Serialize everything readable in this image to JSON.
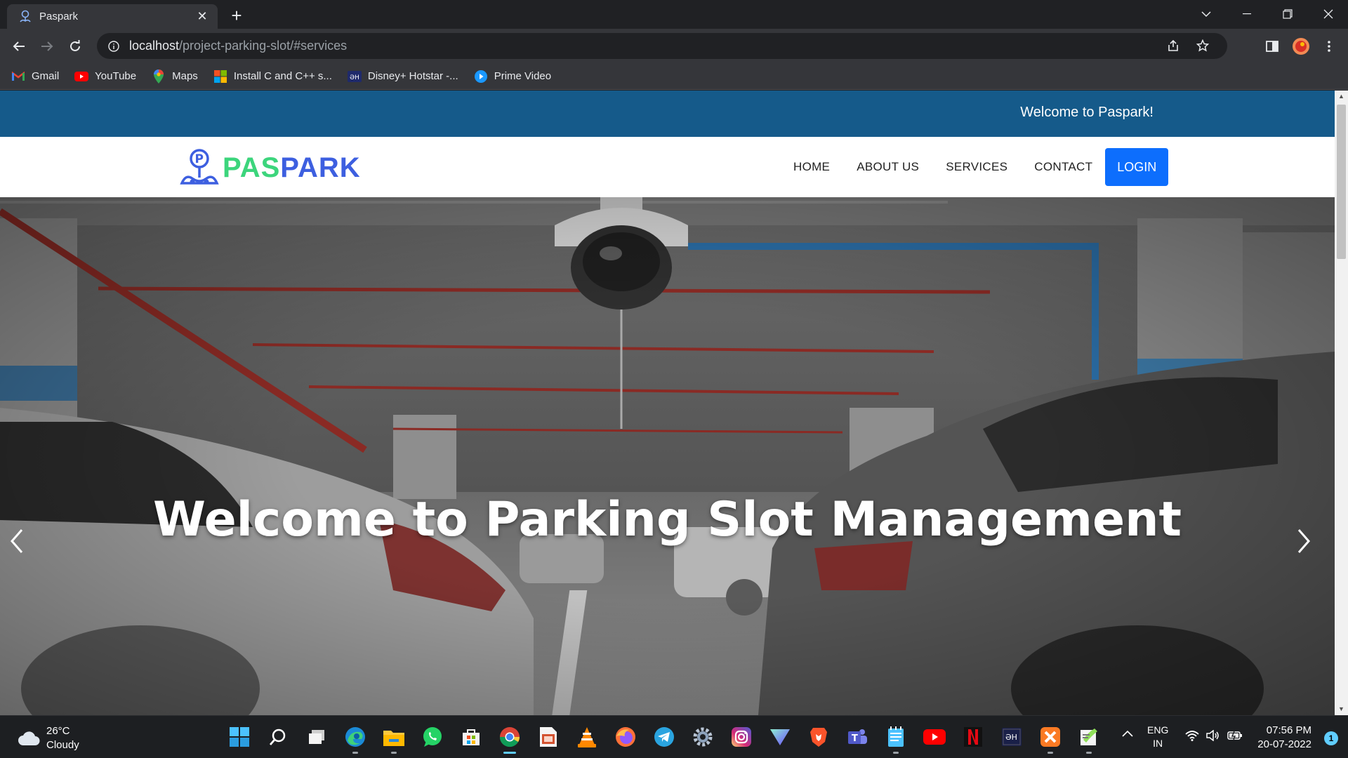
{
  "browser": {
    "tab_title": "Paspark",
    "url_host": "localhost",
    "url_path": "/project-parking-slot/#services",
    "bookmarks": [
      {
        "label": "Gmail",
        "icon": "gmail-icon",
        "color": "#ea4335"
      },
      {
        "label": "YouTube",
        "icon": "youtube-icon",
        "color": "#ff0000"
      },
      {
        "label": "Maps",
        "icon": "maps-icon",
        "color": "#34a853"
      },
      {
        "label": "Install C and C++ s...",
        "icon": "windows-store-icon",
        "color": "#00a4ef"
      },
      {
        "label": "Disney+ Hotstar -...",
        "icon": "hotstar-icon",
        "color": "#1f2a6b"
      },
      {
        "label": "Prime Video",
        "icon": "prime-video-icon",
        "color": "#1a98ff"
      }
    ]
  },
  "page": {
    "topbar_text": "Welcome to Paspark!",
    "logo_part1": "PAS",
    "logo_part2": "PARK",
    "nav": [
      "HOME",
      "ABOUT US",
      "SERVICES",
      "CONTACT"
    ],
    "login_label": "LOGIN",
    "hero_title": "Welcome to Parking Slot Management"
  },
  "taskbar": {
    "temperature": "26°C",
    "weather": "Cloudy",
    "lang_top": "ENG",
    "lang_bottom": "IN",
    "time": "07:56 PM",
    "date": "20-07-2022",
    "notification_count": "1",
    "apps": [
      "windows-start-icon",
      "search-icon",
      "task-view-icon",
      "edge-icon",
      "file-explorer-icon",
      "whatsapp-icon",
      "ms-store-icon",
      "chrome-icon",
      "powerpoint-icon",
      "vlc-icon",
      "firefox-icon",
      "telegram-icon",
      "settings-icon",
      "instagram-icon",
      "proton-vpn-icon",
      "brave-icon",
      "teams-icon",
      "notepad-icon",
      "youtube-icon",
      "netflix-icon",
      "hotstar-icon",
      "xampp-icon",
      "notepad-plus-icon"
    ]
  },
  "colors": {
    "topbar": "#155a8a",
    "login_button": "#0d6efd",
    "logo_green": "#3cd57c",
    "logo_blue": "#3d5fe0"
  }
}
